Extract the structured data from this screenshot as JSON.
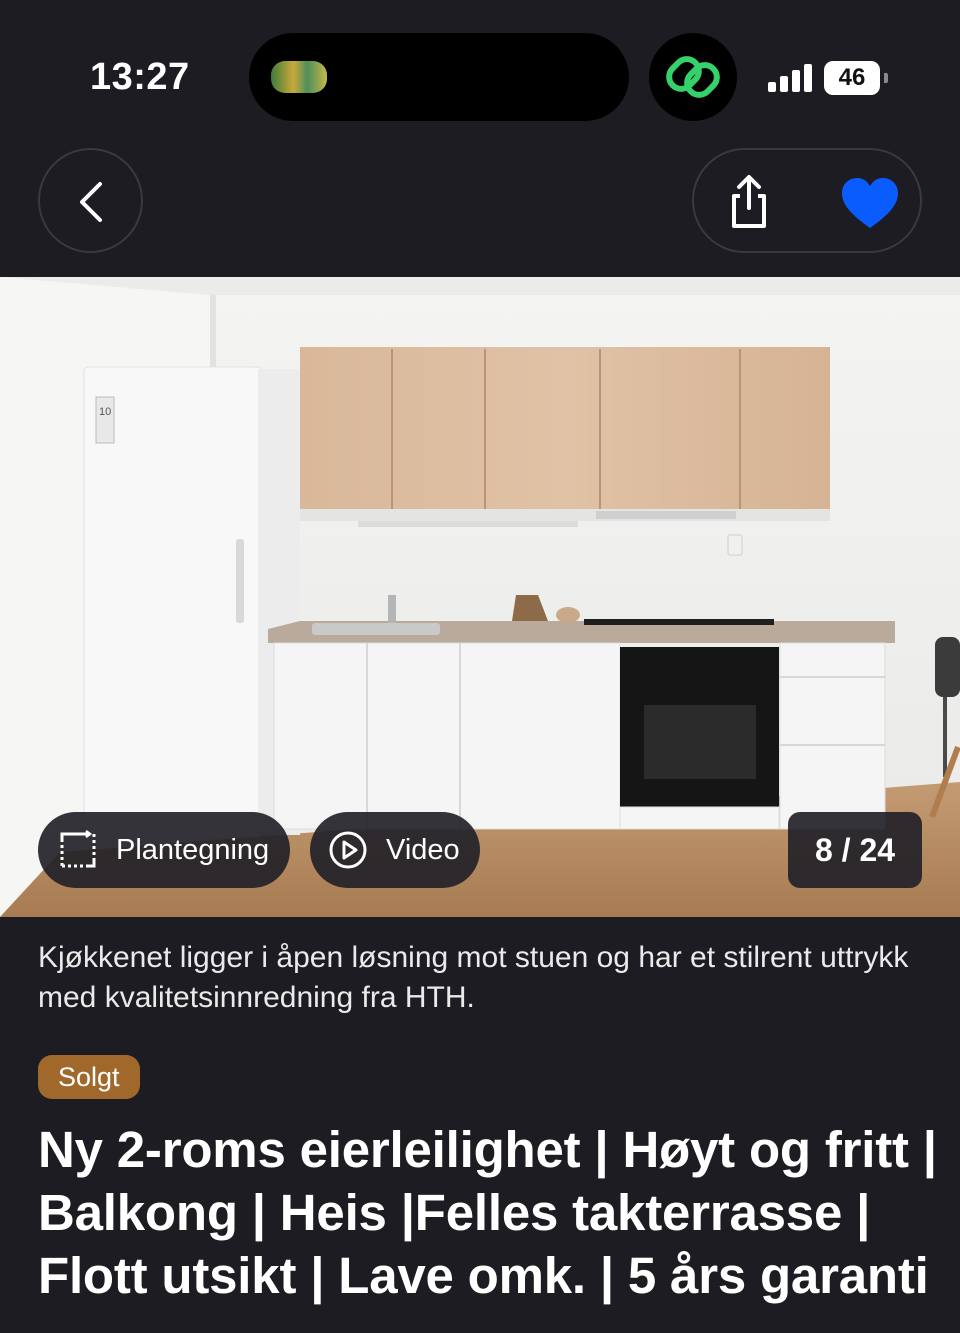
{
  "status_bar": {
    "time": "13:27",
    "battery": "46",
    "app_icon": "link-icon"
  },
  "nav": {
    "back_icon": "chevron-left-icon",
    "share_icon": "share-icon",
    "favorite_icon": "heart-icon",
    "favorite_color": "#0a5cff"
  },
  "gallery": {
    "floorplan_label": "Plantegning",
    "video_label": "Video",
    "counter": "8 / 24",
    "fridge_label": "10"
  },
  "listing": {
    "caption": "Kjøkkenet ligger i åpen løsning mot stuen og har et stilrent uttrykk med kvalitetsinnredning fra HTH.",
    "status_badge": "Solgt",
    "status_color": "#a0682b",
    "title": "Ny 2-roms eierleilighet | Høyt og fritt | Balkong | Heis |Felles takterrasse | Flott utsikt | Lave omk. | 5 års garanti"
  }
}
